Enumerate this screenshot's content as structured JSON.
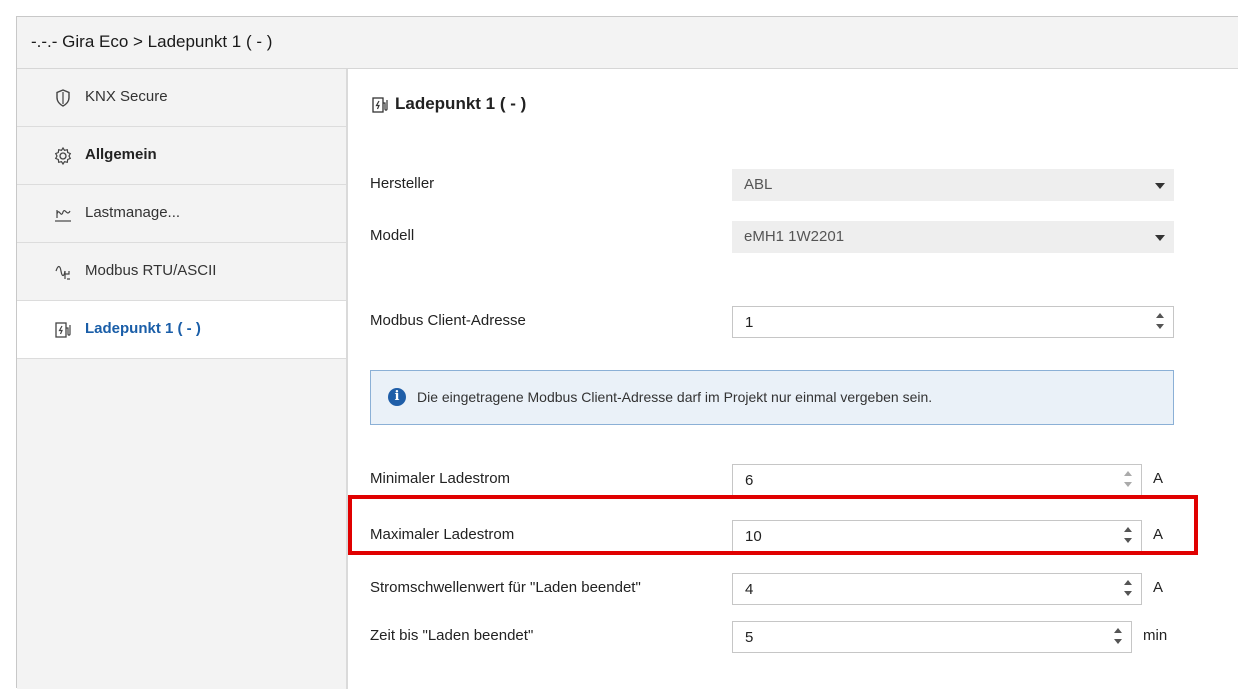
{
  "window": {
    "title": "-.-.- Gira Eco > Ladepunkt 1 ( - )"
  },
  "sidebar": {
    "items": [
      {
        "label": "KNX Secure",
        "icon": "shield-icon",
        "active": false
      },
      {
        "label": "Allgemein",
        "icon": "gear-icon",
        "active": false
      },
      {
        "label": "Lastmanage...",
        "icon": "load-curve-icon",
        "active": false
      },
      {
        "label": "Modbus RTU/ASCII",
        "icon": "modbus-icon",
        "active": false
      },
      {
        "label": "Ladepunkt 1 ( - )",
        "icon": "charging-station-icon",
        "active": true
      }
    ]
  },
  "main": {
    "heading": "Ladepunkt 1 ( - )",
    "heading_icon": "charging-station-icon",
    "hersteller": {
      "label": "Hersteller",
      "value": "ABL"
    },
    "modell": {
      "label": "Modell",
      "value": "eMH1 1W2201"
    },
    "client_address": {
      "label": "Modbus Client-Adresse",
      "value": "1"
    },
    "info": {
      "icon": "info-icon",
      "text": "Die eingetragene Modbus Client-Adresse darf im Projekt nur einmal vergeben sein."
    },
    "min_current": {
      "label": "Minimaler Ladestrom",
      "value": "6",
      "unit": "A"
    },
    "max_current": {
      "label": "Maximaler Ladestrom",
      "value": "10",
      "unit": "A"
    },
    "threshold": {
      "label": "Stromschwellenwert für \"Laden beendet\"",
      "value": "4",
      "unit": "A"
    },
    "time": {
      "label": "Zeit bis \"Laden beendet\"",
      "value": "5",
      "unit": "min"
    }
  },
  "colors": {
    "accent": "#1a5ea8",
    "highlight": "#e00000",
    "info_bg": "#eaf1f8"
  }
}
